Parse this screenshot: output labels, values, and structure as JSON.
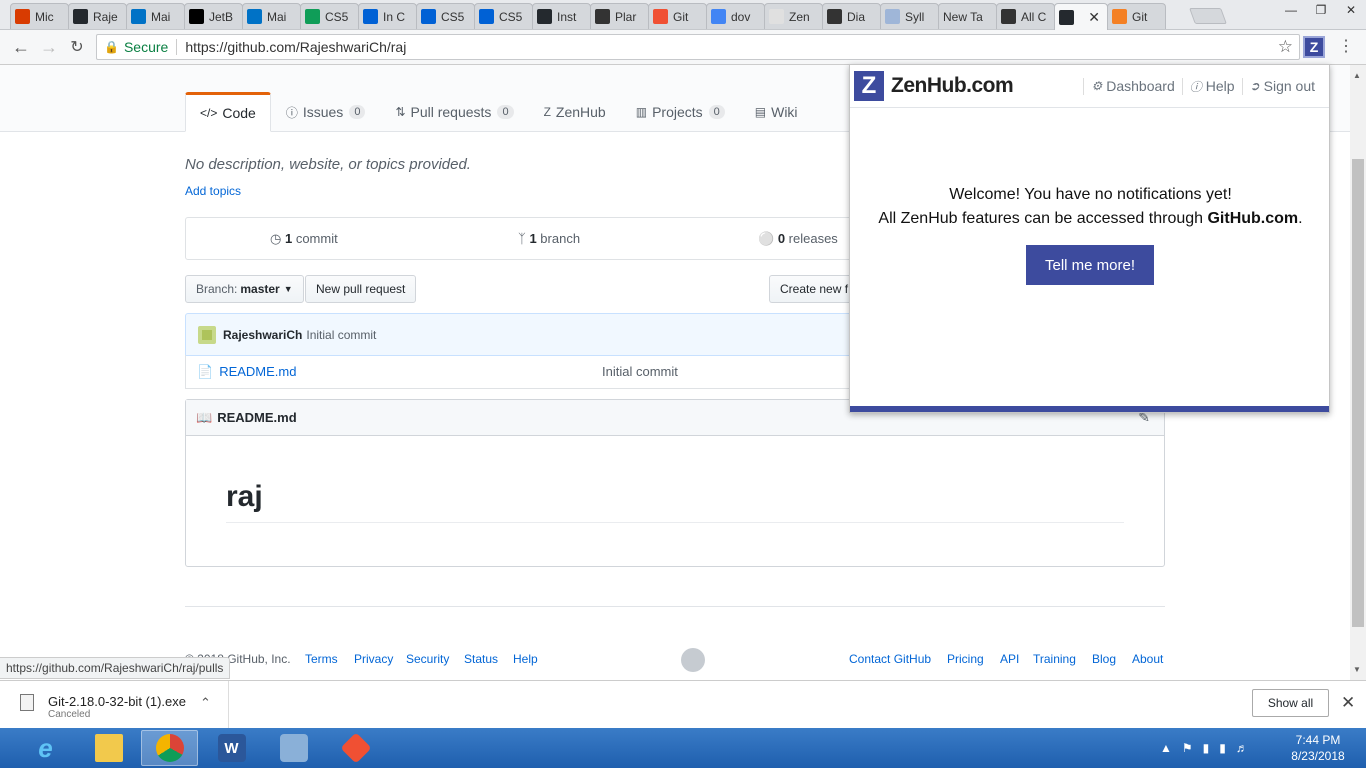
{
  "browser": {
    "tabs": [
      {
        "label": "Mic",
        "icon": "office-icon",
        "color": "#d83b01"
      },
      {
        "label": "Raje",
        "icon": "github-icon",
        "color": "#24292e"
      },
      {
        "label": "Mai",
        "icon": "outlook-icon",
        "color": "#0072c6"
      },
      {
        "label": "JetB",
        "icon": "jetbrains-icon",
        "color": "#000000"
      },
      {
        "label": "Mai",
        "icon": "outlook-icon",
        "color": "#0072c6"
      },
      {
        "label": "CS5",
        "icon": "sheets-icon",
        "color": "#0f9d58"
      },
      {
        "label": "In C",
        "icon": "box-icon",
        "color": "#0061d5"
      },
      {
        "label": "CS5",
        "icon": "box-icon",
        "color": "#0061d5"
      },
      {
        "label": "CS5",
        "icon": "box-icon",
        "color": "#0061d5"
      },
      {
        "label": "Inst",
        "icon": "github-icon",
        "color": "#24292e"
      },
      {
        "label": "Plar",
        "icon": "bulb-icon",
        "color": "#333333"
      },
      {
        "label": "Git",
        "icon": "git-icon",
        "color": "#f05033"
      },
      {
        "label": "dov",
        "icon": "google-icon",
        "color": "#4285f4"
      },
      {
        "label": "Zen",
        "icon": "zenhub-icon",
        "color": "#e0e0e0"
      },
      {
        "label": "Dia",
        "icon": "bulb-icon",
        "color": "#333333"
      },
      {
        "label": "Syll",
        "icon": "umkc-icon",
        "color": "#9fb6d8"
      },
      {
        "label": "New Ta",
        "icon": "",
        "color": ""
      },
      {
        "label": "All C",
        "icon": "bulb-icon",
        "color": "#333333"
      },
      {
        "label": "",
        "icon": "github-icon",
        "color": "#24292e",
        "active": true
      },
      {
        "label": "Git",
        "icon": "stackoverflow-icon",
        "color": "#f48024"
      }
    ],
    "url_secure": "Secure",
    "url": "https://github.com/RajeshwariCh/raj",
    "status_url": "https://github.com/RajeshwariCh/raj/pulls"
  },
  "repo": {
    "nav": [
      {
        "label": "Code",
        "icon": "</>",
        "count": ""
      },
      {
        "label": "Issues",
        "icon": "ⓘ",
        "count": "0"
      },
      {
        "label": "Pull requests",
        "icon": "⇅",
        "count": "0"
      },
      {
        "label": "ZenHub",
        "icon": "Z",
        "count": ""
      },
      {
        "label": "Projects",
        "icon": "▥",
        "count": "0"
      },
      {
        "label": "Wiki",
        "icon": "▤",
        "count": ""
      }
    ],
    "description": "No description, website, or topics provided.",
    "add_topics": "Add topics",
    "commits_num": "1",
    "commits_label": "commit",
    "branches_num": "1",
    "branches_label": "branch",
    "releases_num": "0",
    "releases_label": "releases",
    "branch_prefix": "Branch:",
    "branch_name": "master",
    "new_pr": "New pull request",
    "create_new": "Create new f",
    "commit_author": "RajeshwariCh",
    "commit_msg": "Initial commit",
    "file_name": "README.md",
    "file_commit": "Initial commit",
    "readme_title": "README.md",
    "readme_h1": "raj"
  },
  "footer": {
    "copyright": "© 2018 GitHub, Inc.",
    "terms": "Terms",
    "privacy": "Privacy",
    "security": "Security",
    "status": "Status",
    "help": "Help",
    "contact": "Contact GitHub",
    "pricing": "Pricing",
    "api": "API",
    "training": "Training",
    "blog": "Blog",
    "about": "About"
  },
  "zenhub_popup": {
    "brand": "ZenHub.com",
    "dashboard": "Dashboard",
    "help": "Help",
    "signout": "Sign out",
    "line1": "Welcome! You have no notifications yet!",
    "line2_prefix": "All ZenHub features can be accessed through ",
    "line2_bold": "GitHub.com",
    "line2_suffix": ".",
    "button": "Tell me more!",
    "accent": "#3d4b9e"
  },
  "download": {
    "filename": "Git-2.18.0-32-bit (1).exe",
    "status": "Canceled",
    "show_all": "Show all"
  },
  "taskbar": {
    "time": "7:44 PM",
    "date": "8/23/2018"
  }
}
